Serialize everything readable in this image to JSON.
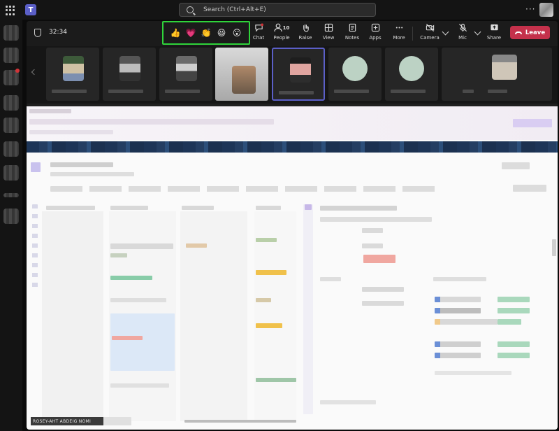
{
  "titlebar": {
    "search_placeholder": "Search (Ctrl+Alt+E)",
    "more": "···"
  },
  "toolbar": {
    "timer": "32:34",
    "reactions": [
      {
        "name": "like",
        "glyph": "👍"
      },
      {
        "name": "heart",
        "glyph": "💗"
      },
      {
        "name": "applause",
        "glyph": "👏"
      },
      {
        "name": "laugh",
        "glyph": "😆"
      },
      {
        "name": "surprised",
        "glyph": "😮"
      }
    ],
    "chat": "Chat",
    "people": "People",
    "people_count": "10",
    "raise": "Raise",
    "view": "View",
    "notes": "Notes",
    "apps": "Apps",
    "more": "More",
    "camera": "Camera",
    "mic": "Mic",
    "share": "Share",
    "leave": "Leave"
  },
  "colors": {
    "accent": "#5b5fc7",
    "leave": "#c4314b",
    "highlight": "#2fd43a",
    "badge": "#d13438"
  },
  "screen": {
    "presenter_label": "ROSEY-AHT ABDEIG NOMI"
  }
}
